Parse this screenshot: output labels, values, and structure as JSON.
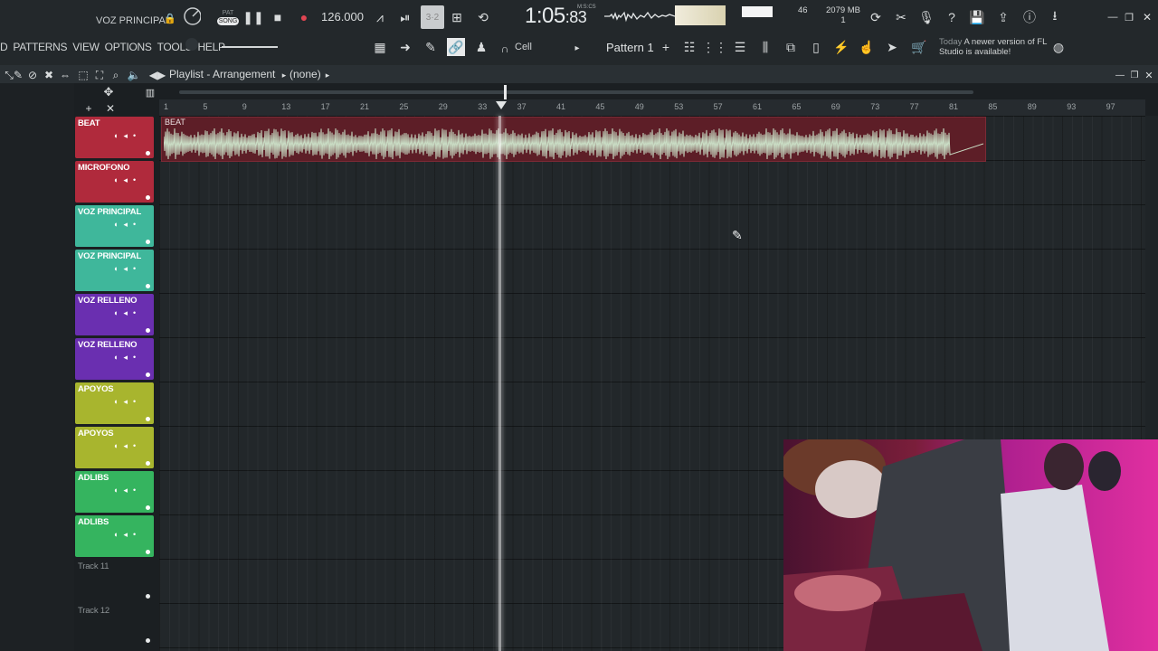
{
  "hint_text": "VOZ PRINCIPAL",
  "mode": {
    "pat": "PAT",
    "song": "SONG"
  },
  "tempo": "126.000",
  "time": {
    "value": "1:05",
    "subvalue": ":83",
    "unit": "M:S:CS"
  },
  "cpu_value": "46",
  "memory": {
    "value": "2079 MB",
    "polyphony": "1"
  },
  "menu": [
    "D",
    "PATTERNS",
    "VIEW",
    "OPTIONS",
    "TOOLS",
    "HELP"
  ],
  "snap": "Cell",
  "pattern": "Pattern 1",
  "pattern_add": "+",
  "notice": {
    "date": "Today",
    "message": "A newer version of FL Studio is available!"
  },
  "playlist": {
    "title": "Playlist - Arrangement",
    "selection": "(none)"
  },
  "ruler_labels": [
    "1",
    "5",
    "9",
    "13",
    "17",
    "21",
    "25",
    "29",
    "33",
    "37",
    "41",
    "45",
    "49",
    "53",
    "57",
    "61",
    "65",
    "69",
    "73",
    "77",
    "81",
    "85",
    "89",
    "93",
    "97"
  ],
  "playhead_bar": "36",
  "clip": {
    "label": "BEAT"
  },
  "tracks": [
    {
      "name": "BEAT",
      "color": "#b02a3c"
    },
    {
      "name": "MICROFONO",
      "color": "#b02a3c"
    },
    {
      "name": "VOZ PRINCIPAL",
      "color": "#3fb79b"
    },
    {
      "name": "VOZ PRINCIPAL",
      "color": "#3fb79b"
    },
    {
      "name": "VOZ RELLENO",
      "color": "#6a2fb0"
    },
    {
      "name": "VOZ RELLENO",
      "color": "#6a2fb0"
    },
    {
      "name": "APOYOS",
      "color": "#a8b52e"
    },
    {
      "name": "APOYOS",
      "color": "#a8b52e"
    },
    {
      "name": "ADLIBS",
      "color": "#35b45f"
    },
    {
      "name": "ADLIBS",
      "color": "#35b45f"
    },
    {
      "name": "Track 11",
      "color": ""
    },
    {
      "name": "Track 12",
      "color": ""
    }
  ]
}
